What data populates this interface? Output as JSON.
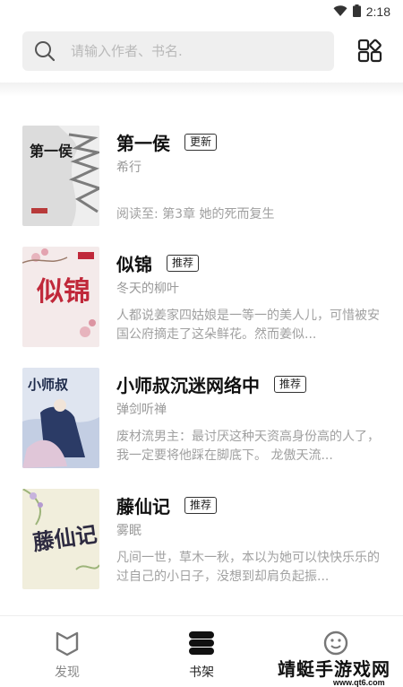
{
  "status_bar": {
    "time": "2:18",
    "icons": [
      "wifi-icon",
      "battery-icon"
    ]
  },
  "search": {
    "placeholder": "请输入作者、书名.",
    "icon": "search-icon"
  },
  "header_actions": {
    "grid_icon": "grid-layout-icon"
  },
  "books": [
    {
      "title": "第一侯",
      "badge": "更新",
      "author": "希行",
      "progress": "阅读至: 第3章 她的死而复生",
      "cover_text": "第一侯",
      "colors": {
        "cover_bg": "#dcdcdc",
        "cover_accent": "#8a8a8a"
      }
    },
    {
      "title": "似锦",
      "badge": "推荐",
      "author": "冬天的柳叶",
      "description": "人都说姜家四姑娘是一等一的美人儿，可惜被安国公府摘走了这朵鲜花。然而姜似...",
      "cover_text": "似锦",
      "colors": {
        "cover_bg": "#f4eaea",
        "cover_accent": "#c0283a"
      }
    },
    {
      "title": "小师叔沉迷网络中",
      "badge": "推荐",
      "author": "弹剑听禅",
      "description": "废材流男主：最讨厌这种天资高身份高的人了，我一定要将他踩在脚底下。 龙傲天流...",
      "cover_text": "小师叔",
      "colors": {
        "cover_bg": "#cfd8ea",
        "cover_accent": "#2b3b66"
      }
    },
    {
      "title": "藤仙记",
      "badge": "推荐",
      "author": "雾眠",
      "description": "凡间一世，草木一秋，本以为她可以快快乐乐的过自己的小日子，没想到却肩负起振...",
      "cover_text": "藤仙记",
      "colors": {
        "cover_bg": "#f1eedc",
        "cover_accent": "#6d4b8c"
      }
    }
  ],
  "tabs": [
    {
      "label": "发现",
      "icon": "discover-icon",
      "active": false
    },
    {
      "label": "书架",
      "icon": "bookshelf-icon",
      "active": true
    },
    {
      "label": "",
      "icon": "smiley-icon",
      "active": false
    }
  ],
  "watermark": {
    "title": "靖蜓手游戏网",
    "url": "www.qt6.com"
  }
}
